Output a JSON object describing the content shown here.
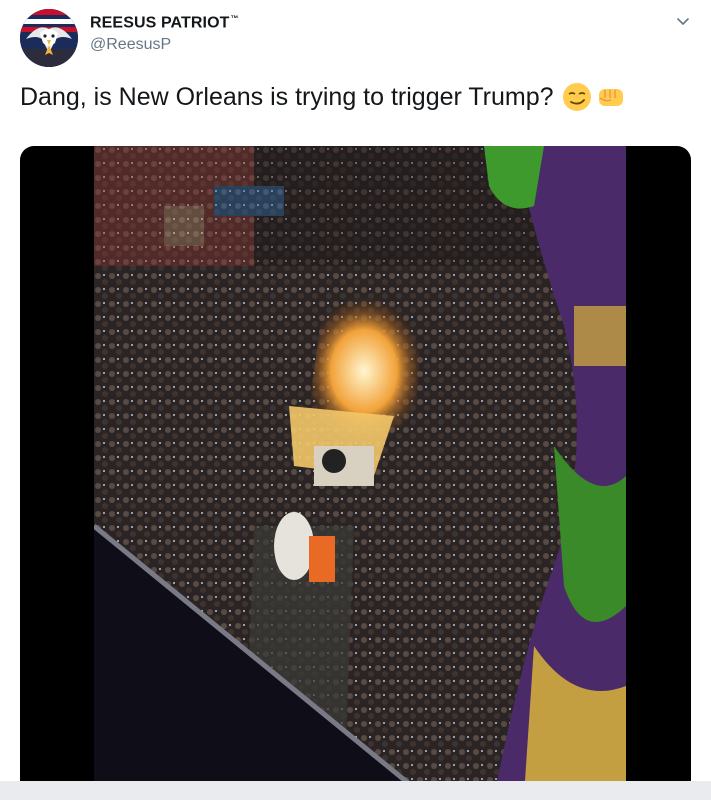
{
  "author": {
    "display_name": "REESUS PATRIOT",
    "trademark": "™",
    "handle": "@ReesusP"
  },
  "tweet": {
    "text": "Dang, is New Orleans is trying to trigger Trump?",
    "emojis": [
      "smirking-face-emoji",
      "oncoming-fist-emoji"
    ]
  },
  "icons": {
    "more_menu": "chevron-down-icon"
  },
  "colors": {
    "name": "#14171a",
    "handle": "#657786",
    "media_background": "#000000",
    "flag_green": "#3a8a2a",
    "flag_purple": "#4b2a6a",
    "flag_gold": "#d9b43a"
  }
}
